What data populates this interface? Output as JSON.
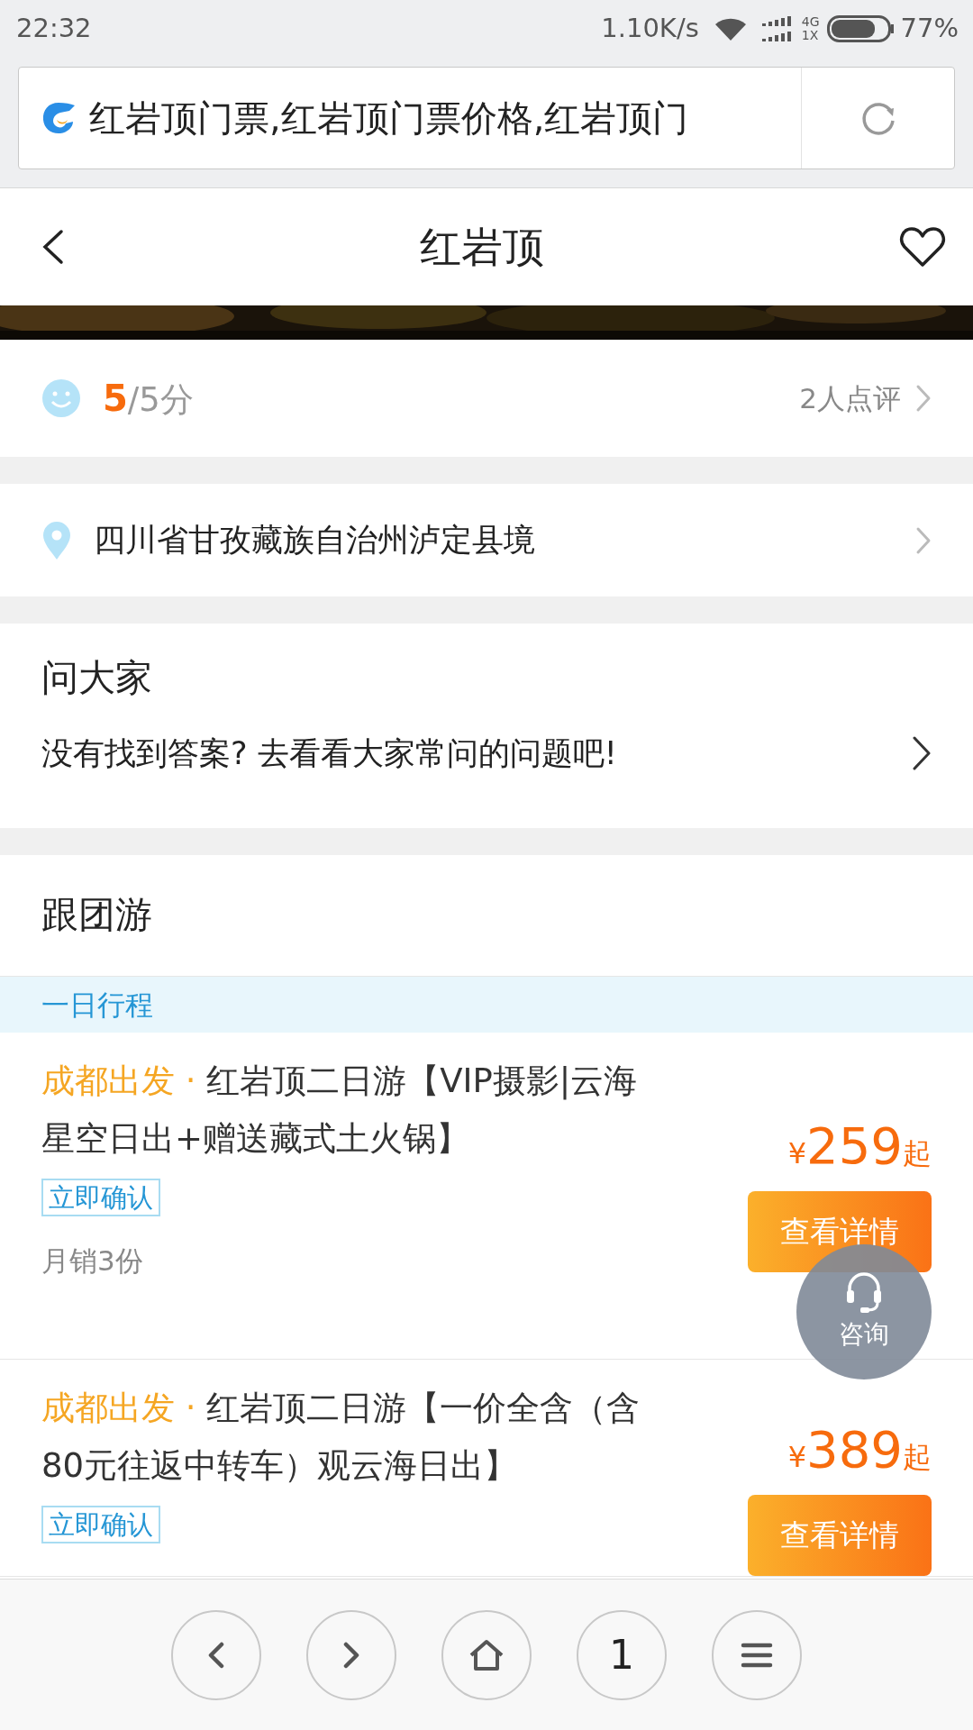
{
  "status_bar": {
    "time": "22:32",
    "speed": "1.10K/s",
    "network_top": "4G",
    "network_bottom": "1X",
    "battery": "77%"
  },
  "address_bar": {
    "text": "红岩顶门票,红岩顶门票价格,红岩顶门"
  },
  "header": {
    "title": "红岩顶",
    "favorited": false
  },
  "rating": {
    "score": "5",
    "suffix": "/5分",
    "reviews": "2人点评"
  },
  "location": {
    "text": "四川省甘孜藏族自治州泸定县境"
  },
  "ask": {
    "title": "问大家",
    "prompt": "没有找到答案? 去看看大家常问的问题吧!"
  },
  "tours": {
    "title": "跟团游",
    "tab": "一日行程",
    "items": [
      {
        "origin": "成都出发 ·",
        "title": "红岩顶二日游【VIP摄影|云海星空日出+赠送藏式土火锅】",
        "tag": "立即确认",
        "sales": "月销3份",
        "currency": "¥",
        "price": "259",
        "price_suffix": "起",
        "button": "查看详情"
      },
      {
        "origin": "成都出发 ·",
        "title": "红岩顶二日游【一价全含（含80元往返中转车）观云海日出】",
        "tag": "立即确认",
        "currency": "¥",
        "price": "389",
        "price_suffix": "起",
        "button": "查看详情"
      }
    ]
  },
  "float_button": {
    "label": "咨询"
  },
  "bottom_nav": [
    {
      "kind": "back"
    },
    {
      "kind": "forward"
    },
    {
      "kind": "home"
    },
    {
      "kind": "tabs",
      "label": "1"
    },
    {
      "kind": "menu"
    }
  ]
}
